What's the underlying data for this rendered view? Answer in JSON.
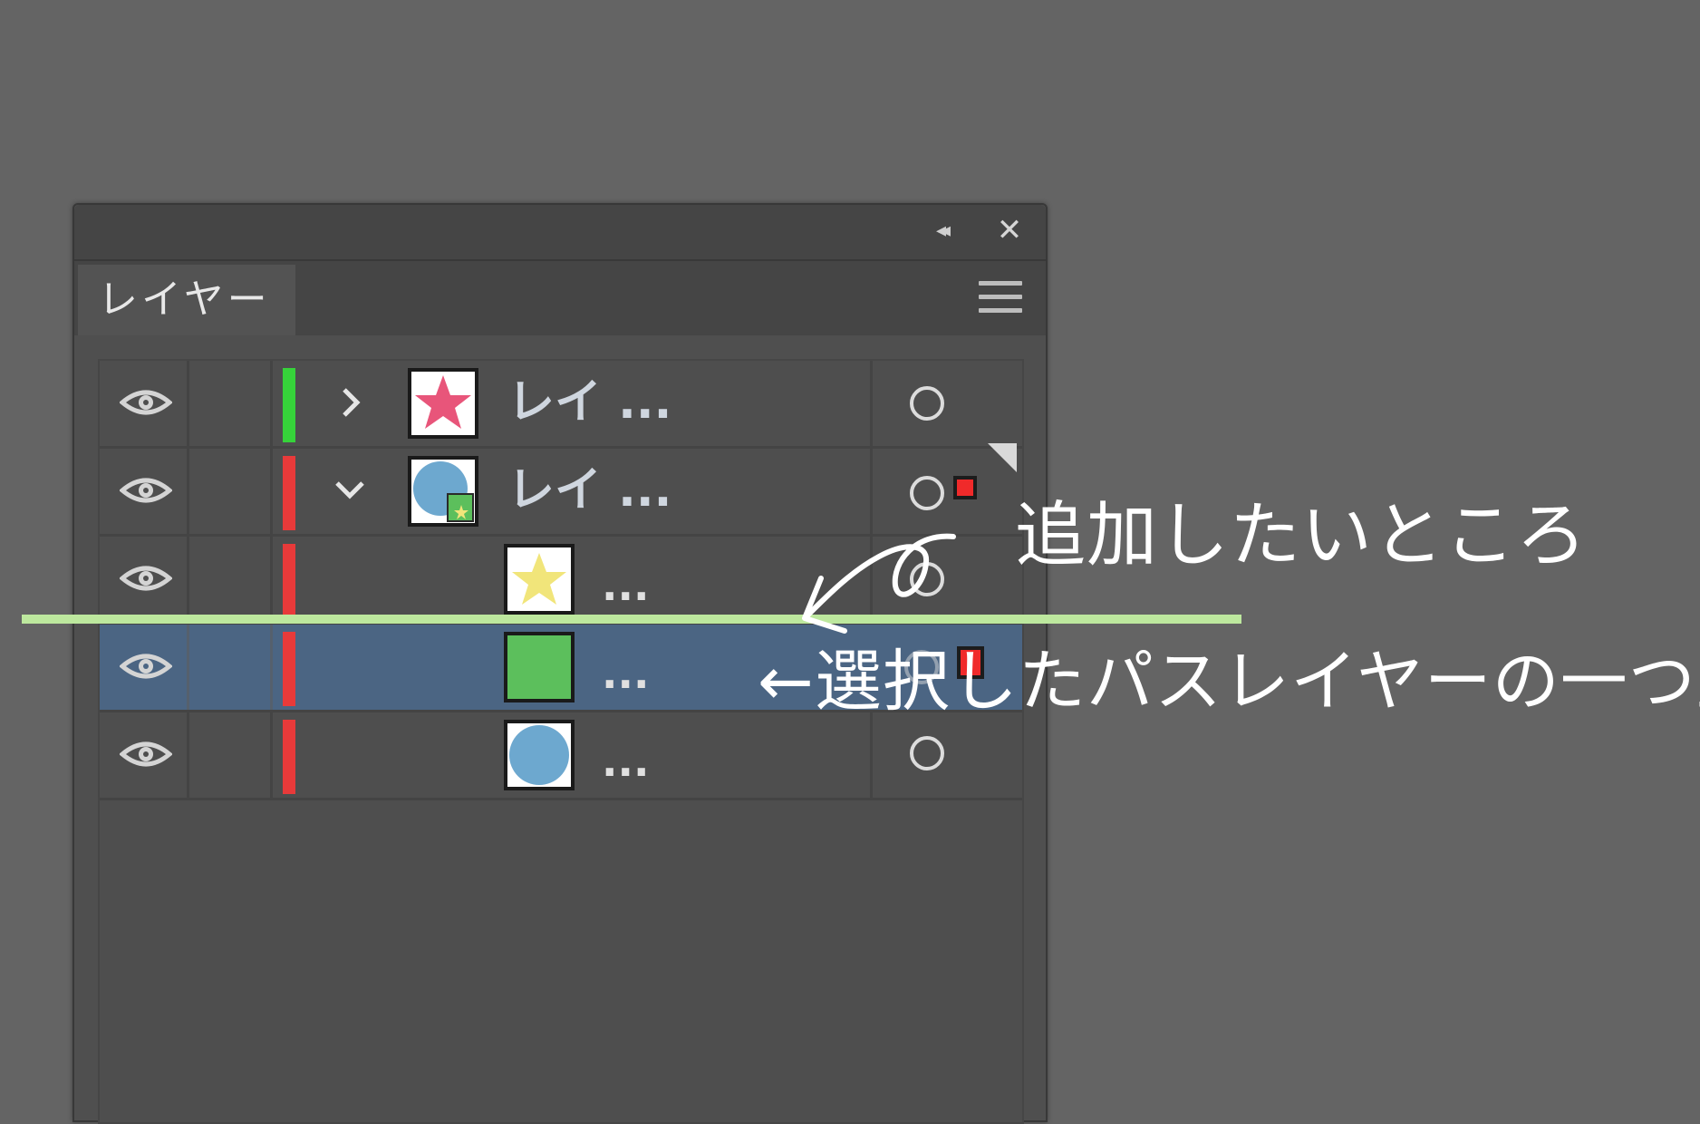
{
  "panel": {
    "tab_label": "レイヤー",
    "collapse_glyph": "◂◂",
    "close_glyph": "✕",
    "menu_icon": "hamburger-icon"
  },
  "layers": [
    {
      "name": "レイ ...",
      "expanded": false,
      "indent": 0,
      "color": "#36d33a",
      "thumb": "star-pink",
      "selected": false
    },
    {
      "name": "レイ ...",
      "expanded": true,
      "indent": 0,
      "color": "#e83a3a",
      "thumb": "circle-blue-square",
      "selected": false
    },
    {
      "name": "...",
      "indent": 1,
      "color": "#e83a3a",
      "thumb": "star-yellow",
      "selected": false
    },
    {
      "name": "...",
      "indent": 1,
      "color": "#e83a3a",
      "thumb": "square-green",
      "selected": true
    },
    {
      "name": "...",
      "indent": 1,
      "color": "#e83a3a",
      "thumb": "circle-blue",
      "selected": false
    }
  ],
  "annotations": {
    "target": "追加したいところ",
    "selected": "←選択したパスレイヤーの一つ上"
  },
  "colors": {
    "background": "#646464",
    "selection": "#4b6583",
    "guide_line": "#bde89e",
    "selection_square": "#f02a2a"
  }
}
